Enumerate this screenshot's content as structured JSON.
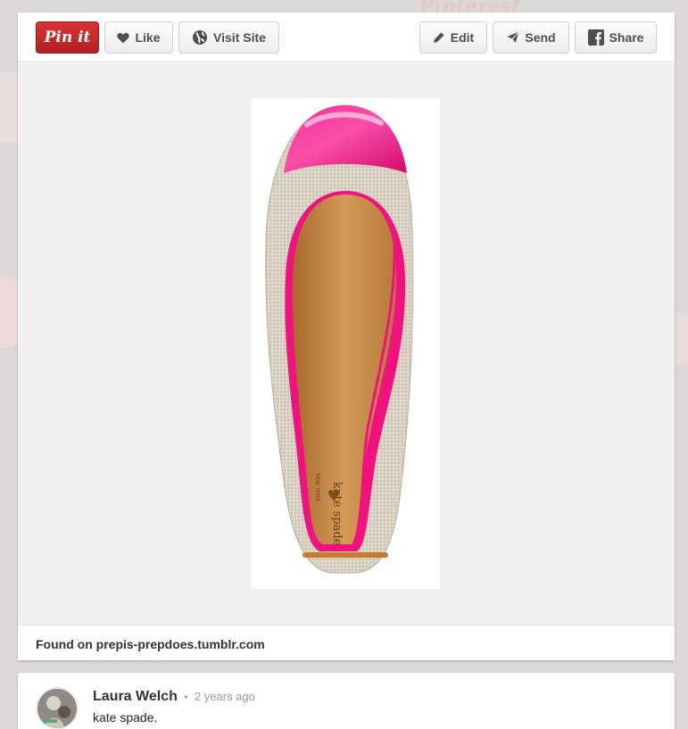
{
  "background": {
    "watermark": "Pinterest"
  },
  "toolbar": {
    "pin_label": "Pin it",
    "like_label": "Like",
    "visit_label": "Visit Site",
    "edit_label": "Edit",
    "send_label": "Send",
    "share_label": "Share"
  },
  "pin": {
    "source_prefix": "Found on",
    "source_domain": "prepis-prepdoes.tumblr.com",
    "insole_brand": "kate spade",
    "insole_city": "NEW YORK"
  },
  "comment": {
    "author": "Laura Welch",
    "separator": "•",
    "time": "2 years ago",
    "text": "kate spade."
  },
  "colors": {
    "pin_red": "#cb2027",
    "toe_pink": "#f0127e",
    "linen": "#d8d0c2",
    "insole": "#c88a45"
  }
}
